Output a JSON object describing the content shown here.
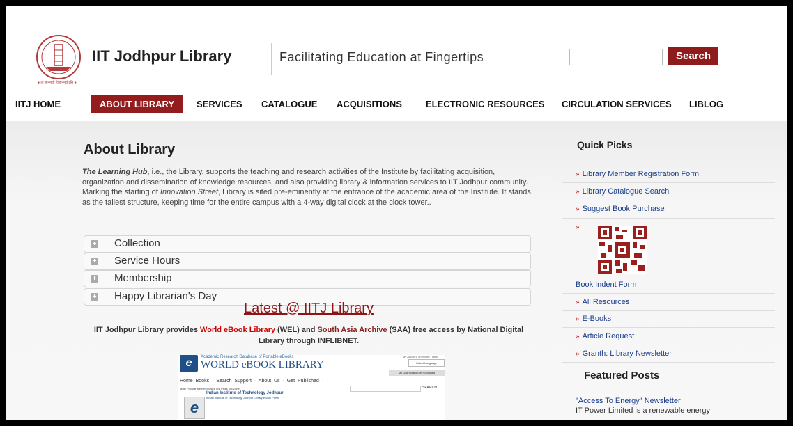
{
  "header": {
    "site_title": "IIT Jodhpur Library",
    "tagline": "Facilitating Education at Fingertips",
    "search_button": "Search",
    "search_value": ""
  },
  "nav": {
    "items": [
      "IITJ HOME",
      "ABOUT LIBRARY",
      "SERVICES",
      "CATALOGUE",
      "ACQUISITIONS",
      "ELECTRONIC RESOURCES",
      "CIRCULATION SERVICES",
      "LIBLOG"
    ],
    "active": "ABOUT LIBRARY"
  },
  "main": {
    "heading": "About Library",
    "intro_lead": "The Learning Hub",
    "intro_1": ", i.e., the Library, supports the teaching and research activities of the Institute by facilitating acquisition, organization and dissemination of knowledge resources, and also providing library & information services to IIT Jodhpur community. Marking the starting of ",
    "intro_em": "Innovation Street",
    "intro_2": ", Library is sited pre-eminently at the entrance of the academic area of the Institute. It stands as the tallest structure, keeping time for the entire campus with a 4-way digital clock at the clock tower..",
    "accordion": [
      "Collection",
      "Service Hours",
      "Membership",
      "Happy Librarian's Day"
    ],
    "latest_title": "Latest @ IITJ Library",
    "provides_1": "IIT Jodhpur Library provides ",
    "provides_wel": "World eBook Library",
    "provides_2": " (WEL) and ",
    "provides_saa": "South Asia Archive",
    "provides_3": " (SAA) free access by National Digital Library through INFLIBNET.",
    "wel_banner": {
      "subtitle": "Academic Research Database of Portable eBooks",
      "title": "WORLD eBOOK LIBRARY",
      "account": "My Account | Register | Help",
      "language": "Select Language",
      "dashboard": "My Dashboard   Get Published",
      "menu": "Home   Books ·   Search   Support ·   About Us ·   Get Published ·",
      "submenu": "Most Popular   New Releases   Top Picks   Kid Zone",
      "search_btn": "SEARCH",
      "institute": "Indian Institute of Technology Jodhpur",
      "institute_sub": "Indian Institute of Technology Jodhpur Library eBook Portal"
    }
  },
  "sidebar": {
    "quick_picks_title": "Quick Picks",
    "quick_picks": [
      "Library Member Registration Form",
      "Library Catalogue Search",
      "Suggest Book Purchase"
    ],
    "qr_caption": "Book Indent Form",
    "more_picks": [
      "All Resources",
      "E-Books",
      "Article Request",
      "Granth: Library Newsletter"
    ],
    "featured_title": "Featured Posts",
    "featured_link": "\"Access To Energy\" Newsletter",
    "featured_text": "IT Power Limited is a renewable energy"
  },
  "colors": {
    "brand_red": "#931c1c",
    "link_blue": "#1b3f8b"
  }
}
